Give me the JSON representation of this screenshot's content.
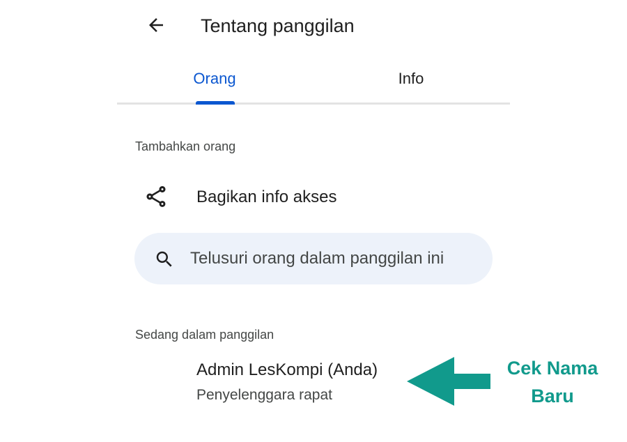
{
  "header": {
    "back_icon": "arrow-back-icon",
    "title": "Tentang panggilan"
  },
  "tabs": [
    {
      "label": "Orang",
      "selected": true
    },
    {
      "label": "Info",
      "selected": false
    }
  ],
  "colors": {
    "accent": "#0b57d0",
    "search_background": "#edf2fa",
    "annotation": "#119a8c"
  },
  "add_people": {
    "section_label": "Tambahkan orang",
    "share_icon": "share-icon",
    "share_label": "Bagikan info akses"
  },
  "search": {
    "icon": "search-icon",
    "placeholder": "Telusuri orang dalam panggilan ini",
    "value": ""
  },
  "in_call": {
    "section_label": "Sedang dalam panggilan",
    "participants": [
      {
        "name": "Admin LesKompi (Anda)",
        "role": "Penyelenggara rapat"
      }
    ]
  },
  "annotation": {
    "text": "Cek Nama Baru",
    "arrow_icon": "arrow-left-annotation-icon"
  }
}
